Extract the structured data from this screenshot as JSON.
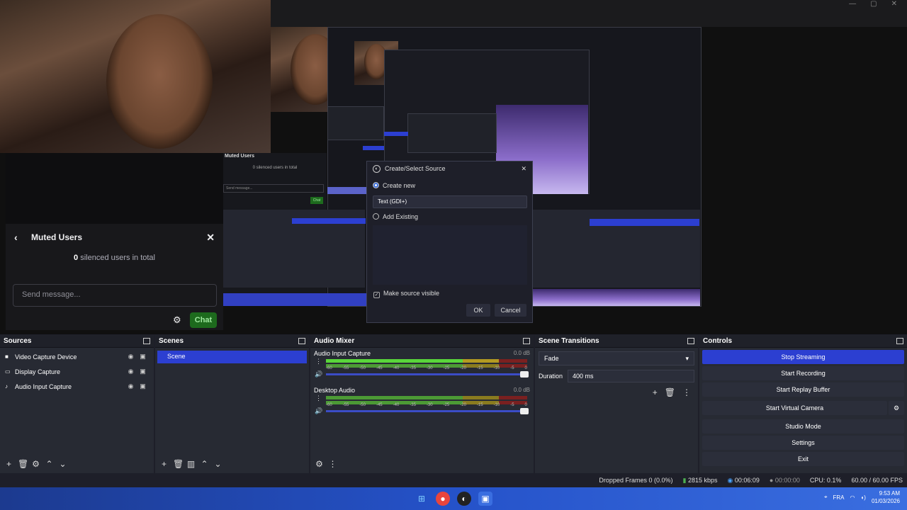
{
  "window": {
    "minimize_glyph": "—",
    "maximize_glyph": "▢",
    "close_glyph": "✕"
  },
  "chat": {
    "title": "Muted Users",
    "back_icon": "chevron-left-icon",
    "silenced_count": "0",
    "silenced_text": "silenced users in total",
    "send_placeholder": "Send message...",
    "chat_button": "Chat"
  },
  "nested_preview": {
    "muted_users": "Muted Users",
    "silenced": "0 silenced users in total",
    "send": "Send message...",
    "chat": "Chat"
  },
  "dialog": {
    "title": "Create/Select Source",
    "create_new": "Create new",
    "name_value": "Text (GDI+)",
    "add_existing": "Add Existing",
    "make_visible": "Make source visible",
    "ok": "OK",
    "cancel": "Cancel"
  },
  "sources": {
    "title": "Sources",
    "items": [
      {
        "label": "Video Capture Device",
        "icon": "camera-icon"
      },
      {
        "label": "Display Capture",
        "icon": "monitor-icon"
      },
      {
        "label": "Audio Input Capture",
        "icon": "microphone-icon"
      }
    ]
  },
  "scenes": {
    "title": "Scenes",
    "items": [
      "Scene"
    ]
  },
  "mixer": {
    "title": "Audio Mixer",
    "channels": [
      {
        "name": "Audio Input Capture",
        "db": "0.0 dB"
      },
      {
        "name": "Desktop Audio",
        "db": "0.0 dB"
      }
    ],
    "ticks": [
      "-60",
      "-55",
      "-50",
      "-45",
      "-40",
      "-35",
      "-30",
      "-25",
      "-20",
      "-15",
      "-10",
      "-5",
      "0"
    ]
  },
  "transitions": {
    "title": "Scene Transitions",
    "selected": "Fade",
    "duration_label": "Duration",
    "duration_value": "400 ms"
  },
  "controls": {
    "title": "Controls",
    "buttons": [
      "Stop Streaming",
      "Start Recording",
      "Start Replay Buffer",
      "Start Virtual Camera",
      "Studio Mode",
      "Settings",
      "Exit"
    ]
  },
  "status": {
    "dropped_frames": "Dropped Frames 0 (0.0%)",
    "bitrate": "2815 kbps",
    "stream_time": "00:06:09",
    "rec_time": "00:00:00",
    "cpu": "CPU: 0.1%",
    "fps": "60.00 / 60.00 FPS"
  },
  "taskbar": {
    "lang": "FRA",
    "time": "9:53 AM",
    "date": "01/03/2026"
  },
  "colors": {
    "accent": "#2c3fd1",
    "chat_green": "#1d6a1d",
    "dock_bg": "#272a33"
  }
}
